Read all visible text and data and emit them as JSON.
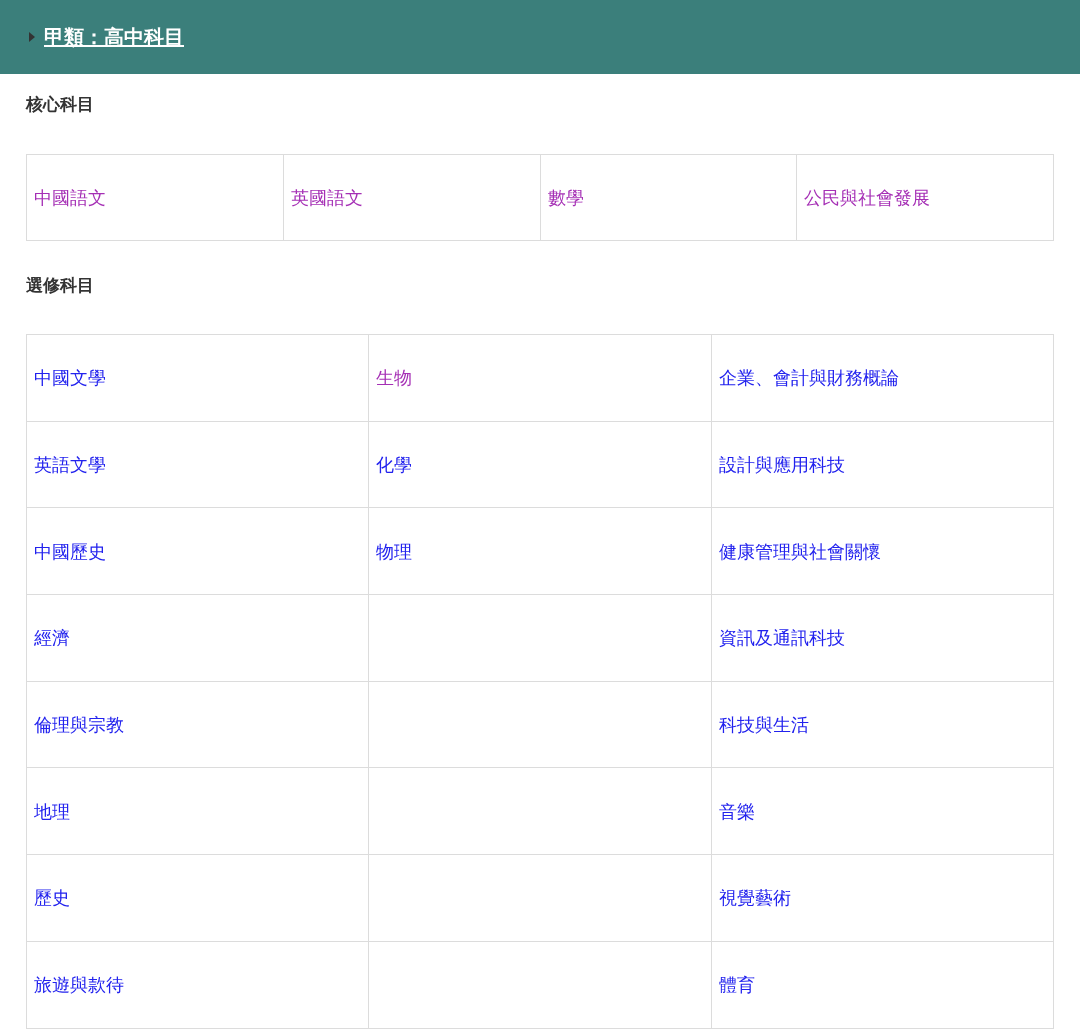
{
  "header": {
    "title": "甲類：高中科目",
    "expanded": false
  },
  "core": {
    "heading": "核心科目",
    "cells": [
      {
        "text": "中國語文",
        "visited": true
      },
      {
        "text": "英國語文",
        "visited": true
      },
      {
        "text": "數學",
        "visited": true
      },
      {
        "text": "公民與社會發展",
        "visited": true
      }
    ]
  },
  "elective": {
    "heading": "選修科目",
    "rows": [
      {
        "col_1": {
          "text": "中國文學",
          "visited": false
        },
        "col_2": {
          "text": "生物",
          "visited": true
        },
        "col_3": {
          "text": "企業、會計與財務概論",
          "visited": false
        }
      },
      {
        "col_1": {
          "text": "英語文學",
          "visited": false
        },
        "col_2": {
          "text": "化學",
          "visited": false
        },
        "col_3": {
          "text": "設計與應用科技",
          "visited": false
        }
      },
      {
        "col_1": {
          "text": "中國歷史",
          "visited": false
        },
        "col_2": {
          "text": "物理",
          "visited": false
        },
        "col_3": {
          "text": "健康管理與社會關懷",
          "visited": false
        }
      },
      {
        "col_1": {
          "text": "經濟",
          "visited": false
        },
        "col_3": {
          "text": "資訊及通訊科技",
          "visited": false
        }
      },
      {
        "col_1": {
          "text": "倫理與宗教",
          "visited": false
        },
        "col_3": {
          "text": "科技與生活",
          "visited": false
        }
      },
      {
        "col_1": {
          "text": "地理",
          "visited": false
        },
        "col_3": {
          "text": "音樂",
          "visited": false
        }
      },
      {
        "col_1": {
          "text": "歷史",
          "visited": false
        },
        "col_3": {
          "text": "視覺藝術",
          "visited": false
        }
      },
      {
        "col_1": {
          "text": "旅遊與款待",
          "visited": false
        },
        "col_3": {
          "text": "體育",
          "visited": false
        }
      }
    ]
  }
}
